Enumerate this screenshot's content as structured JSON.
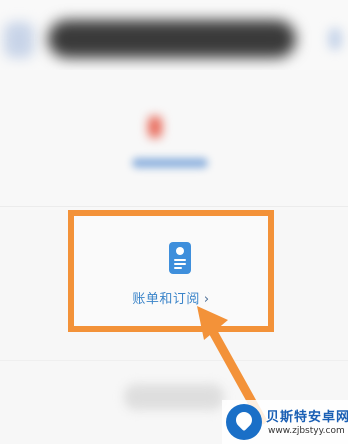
{
  "billing": {
    "label": "账单和订阅",
    "chevron": "›"
  },
  "icons": {
    "billing_icon": "document-apple-icon"
  },
  "colors": {
    "highlight_border": "#f39239",
    "link_blue": "#3a84c9",
    "icon_blue": "#3e8fdc"
  },
  "watermark": {
    "title": "贝斯特安卓网",
    "url": "www.zjbstyy.com"
  }
}
